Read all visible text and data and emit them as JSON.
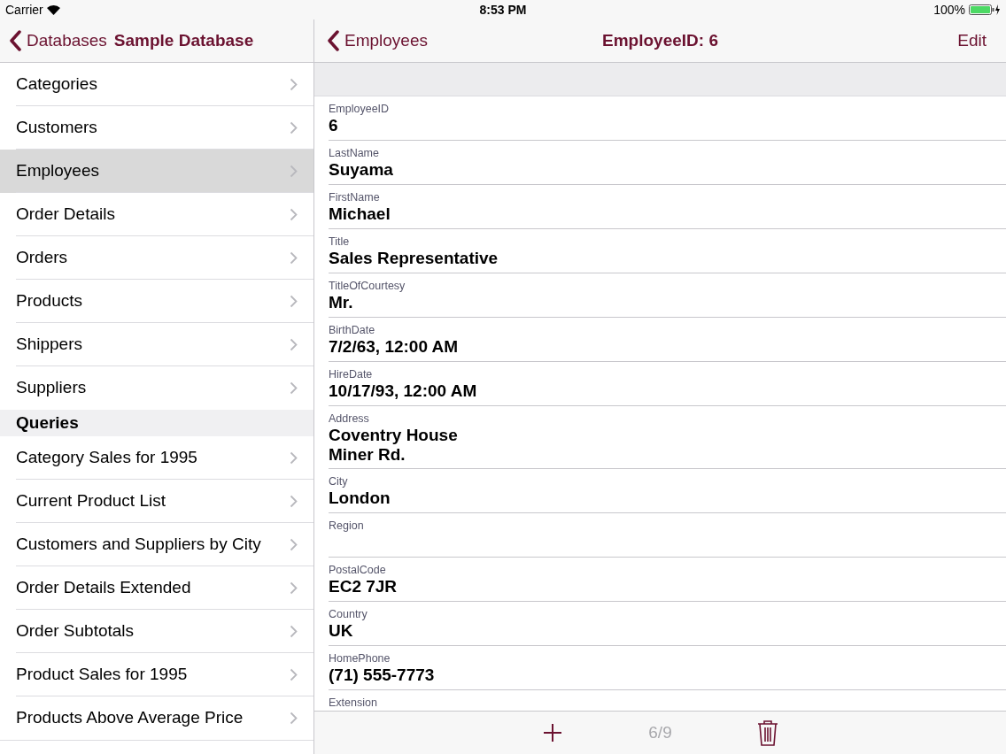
{
  "status_bar": {
    "carrier": "Carrier",
    "time": "8:53 PM",
    "battery": "100%"
  },
  "sidebar": {
    "back": "Databases",
    "title": "Sample Database",
    "sections": [
      {
        "items": [
          {
            "label": "Categories",
            "selected": false
          },
          {
            "label": "Customers",
            "selected": false
          },
          {
            "label": "Employees",
            "selected": true
          },
          {
            "label": "Order Details",
            "selected": false
          },
          {
            "label": "Orders",
            "selected": false
          },
          {
            "label": "Products",
            "selected": false
          },
          {
            "label": "Shippers",
            "selected": false
          },
          {
            "label": "Suppliers",
            "selected": false
          }
        ]
      },
      {
        "header": "Queries",
        "items": [
          {
            "label": "Category Sales for 1995",
            "selected": false
          },
          {
            "label": "Current Product List",
            "selected": false
          },
          {
            "label": "Customers and Suppliers by City",
            "selected": false
          },
          {
            "label": "Order Details Extended",
            "selected": false
          },
          {
            "label": "Order Subtotals",
            "selected": false
          },
          {
            "label": "Product Sales for 1995",
            "selected": false
          },
          {
            "label": "Products Above Average Price",
            "selected": false
          }
        ]
      }
    ]
  },
  "detail": {
    "back": "Employees",
    "title": "EmployeeID: 6",
    "edit": "Edit",
    "fields": [
      {
        "label": "EmployeeID",
        "lines": [
          "6"
        ]
      },
      {
        "label": "LastName",
        "lines": [
          "Suyama"
        ]
      },
      {
        "label": "FirstName",
        "lines": [
          "Michael"
        ]
      },
      {
        "label": "Title",
        "lines": [
          "Sales Representative"
        ]
      },
      {
        "label": "TitleOfCourtesy",
        "lines": [
          "Mr."
        ]
      },
      {
        "label": "BirthDate",
        "lines": [
          "7/2/63, 12:00 AM"
        ]
      },
      {
        "label": "HireDate",
        "lines": [
          "10/17/93, 12:00 AM"
        ]
      },
      {
        "label": "Address",
        "lines": [
          "Coventry House",
          "Miner Rd."
        ]
      },
      {
        "label": "City",
        "lines": [
          "London"
        ]
      },
      {
        "label": "Region"
      },
      {
        "label": "PostalCode",
        "lines": [
          "EC2 7JR"
        ]
      },
      {
        "label": "Country",
        "lines": [
          "UK"
        ]
      },
      {
        "label": "HomePhone",
        "lines": [
          "(71) 555-7773"
        ]
      },
      {
        "label": "Extension"
      }
    ],
    "toolbar": {
      "position": "6/9"
    }
  }
}
